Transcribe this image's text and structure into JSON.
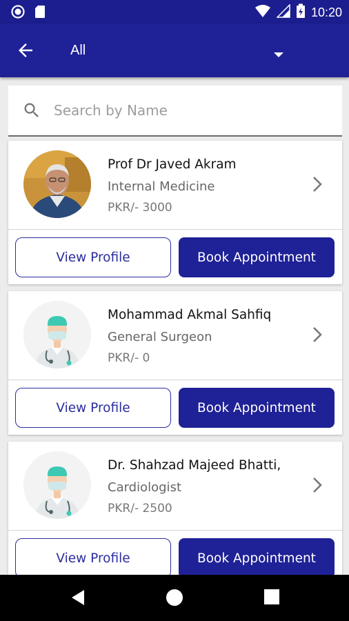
{
  "status_bar": {
    "time": "10:20",
    "icons": [
      "circle-notification-icon",
      "sd-card-icon",
      "wifi-icon",
      "cell-signal-icon",
      "battery-charging-icon"
    ]
  },
  "app_bar": {
    "back_icon": "arrow-back-icon",
    "filter_value": "All",
    "dropdown_icon": "dropdown-arrow-icon"
  },
  "search": {
    "placeholder": "Search by Name",
    "value": ""
  },
  "doctors": [
    {
      "name": "Prof Dr Javed Akram",
      "specialty": "Internal Medicine",
      "fee": "PKR/- 3000",
      "avatar": "doctor-photo",
      "view_label": "View Profile",
      "book_label": "Book Appointment"
    },
    {
      "name": "Mohammad Akmal Sahfiq",
      "specialty": "General Surgeon",
      "fee": "PKR/- 0",
      "avatar": "doctor-placeholder-icon",
      "view_label": "View Profile",
      "book_label": "Book Appointment"
    },
    {
      "name": "Dr. Shahzad Majeed Bhatti,",
      "specialty": "Cardiologist",
      "fee": "PKR/- 2500",
      "avatar": "doctor-placeholder-icon",
      "view_label": "View Profile",
      "book_label": "Book Appointment"
    }
  ],
  "nav_bar": {
    "icons": [
      "back-triangle-icon",
      "home-circle-icon",
      "recents-square-icon"
    ]
  },
  "colors": {
    "primary": "#1f2196",
    "status_bar": "#1c1e8f",
    "background": "#ececec"
  }
}
